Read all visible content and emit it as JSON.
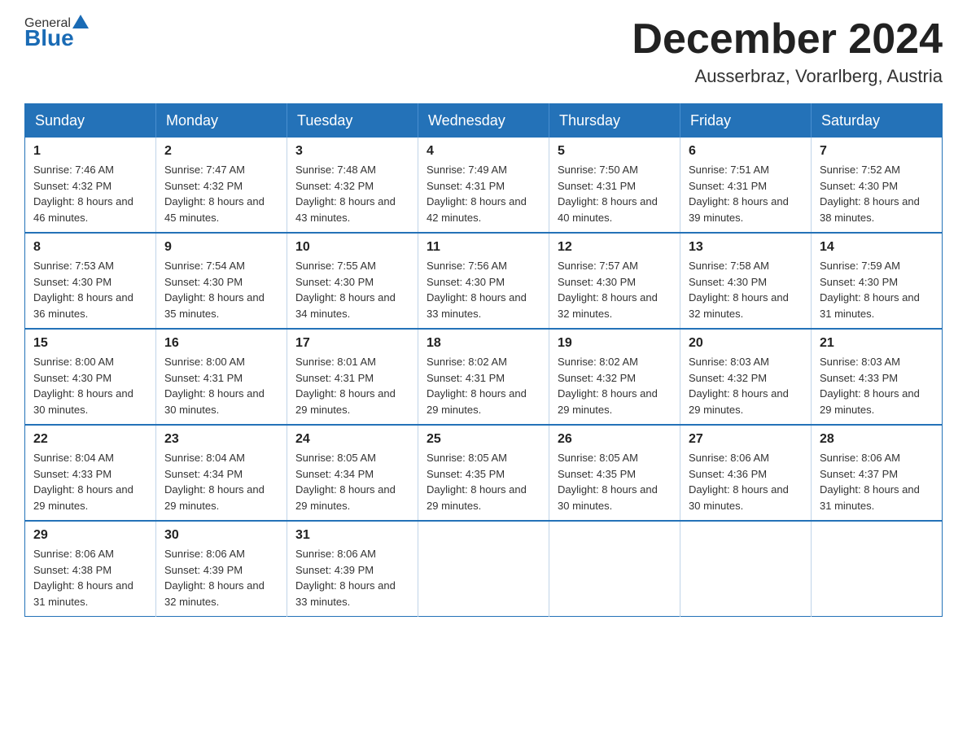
{
  "header": {
    "logo_general": "General",
    "logo_blue": "Blue",
    "month_title": "December 2024",
    "location": "Ausserbraz, Vorarlberg, Austria"
  },
  "weekdays": [
    "Sunday",
    "Monday",
    "Tuesday",
    "Wednesday",
    "Thursday",
    "Friday",
    "Saturday"
  ],
  "weeks": [
    [
      {
        "day": "1",
        "sunrise": "7:46 AM",
        "sunset": "4:32 PM",
        "daylight": "8 hours and 46 minutes."
      },
      {
        "day": "2",
        "sunrise": "7:47 AM",
        "sunset": "4:32 PM",
        "daylight": "8 hours and 45 minutes."
      },
      {
        "day": "3",
        "sunrise": "7:48 AM",
        "sunset": "4:32 PM",
        "daylight": "8 hours and 43 minutes."
      },
      {
        "day": "4",
        "sunrise": "7:49 AM",
        "sunset": "4:31 PM",
        "daylight": "8 hours and 42 minutes."
      },
      {
        "day": "5",
        "sunrise": "7:50 AM",
        "sunset": "4:31 PM",
        "daylight": "8 hours and 40 minutes."
      },
      {
        "day": "6",
        "sunrise": "7:51 AM",
        "sunset": "4:31 PM",
        "daylight": "8 hours and 39 minutes."
      },
      {
        "day": "7",
        "sunrise": "7:52 AM",
        "sunset": "4:30 PM",
        "daylight": "8 hours and 38 minutes."
      }
    ],
    [
      {
        "day": "8",
        "sunrise": "7:53 AM",
        "sunset": "4:30 PM",
        "daylight": "8 hours and 36 minutes."
      },
      {
        "day": "9",
        "sunrise": "7:54 AM",
        "sunset": "4:30 PM",
        "daylight": "8 hours and 35 minutes."
      },
      {
        "day": "10",
        "sunrise": "7:55 AM",
        "sunset": "4:30 PM",
        "daylight": "8 hours and 34 minutes."
      },
      {
        "day": "11",
        "sunrise": "7:56 AM",
        "sunset": "4:30 PM",
        "daylight": "8 hours and 33 minutes."
      },
      {
        "day": "12",
        "sunrise": "7:57 AM",
        "sunset": "4:30 PM",
        "daylight": "8 hours and 32 minutes."
      },
      {
        "day": "13",
        "sunrise": "7:58 AM",
        "sunset": "4:30 PM",
        "daylight": "8 hours and 32 minutes."
      },
      {
        "day": "14",
        "sunrise": "7:59 AM",
        "sunset": "4:30 PM",
        "daylight": "8 hours and 31 minutes."
      }
    ],
    [
      {
        "day": "15",
        "sunrise": "8:00 AM",
        "sunset": "4:30 PM",
        "daylight": "8 hours and 30 minutes."
      },
      {
        "day": "16",
        "sunrise": "8:00 AM",
        "sunset": "4:31 PM",
        "daylight": "8 hours and 30 minutes."
      },
      {
        "day": "17",
        "sunrise": "8:01 AM",
        "sunset": "4:31 PM",
        "daylight": "8 hours and 29 minutes."
      },
      {
        "day": "18",
        "sunrise": "8:02 AM",
        "sunset": "4:31 PM",
        "daylight": "8 hours and 29 minutes."
      },
      {
        "day": "19",
        "sunrise": "8:02 AM",
        "sunset": "4:32 PM",
        "daylight": "8 hours and 29 minutes."
      },
      {
        "day": "20",
        "sunrise": "8:03 AM",
        "sunset": "4:32 PM",
        "daylight": "8 hours and 29 minutes."
      },
      {
        "day": "21",
        "sunrise": "8:03 AM",
        "sunset": "4:33 PM",
        "daylight": "8 hours and 29 minutes."
      }
    ],
    [
      {
        "day": "22",
        "sunrise": "8:04 AM",
        "sunset": "4:33 PM",
        "daylight": "8 hours and 29 minutes."
      },
      {
        "day": "23",
        "sunrise": "8:04 AM",
        "sunset": "4:34 PM",
        "daylight": "8 hours and 29 minutes."
      },
      {
        "day": "24",
        "sunrise": "8:05 AM",
        "sunset": "4:34 PM",
        "daylight": "8 hours and 29 minutes."
      },
      {
        "day": "25",
        "sunrise": "8:05 AM",
        "sunset": "4:35 PM",
        "daylight": "8 hours and 29 minutes."
      },
      {
        "day": "26",
        "sunrise": "8:05 AM",
        "sunset": "4:35 PM",
        "daylight": "8 hours and 30 minutes."
      },
      {
        "day": "27",
        "sunrise": "8:06 AM",
        "sunset": "4:36 PM",
        "daylight": "8 hours and 30 minutes."
      },
      {
        "day": "28",
        "sunrise": "8:06 AM",
        "sunset": "4:37 PM",
        "daylight": "8 hours and 31 minutes."
      }
    ],
    [
      {
        "day": "29",
        "sunrise": "8:06 AM",
        "sunset": "4:38 PM",
        "daylight": "8 hours and 31 minutes."
      },
      {
        "day": "30",
        "sunrise": "8:06 AM",
        "sunset": "4:39 PM",
        "daylight": "8 hours and 32 minutes."
      },
      {
        "day": "31",
        "sunrise": "8:06 AM",
        "sunset": "4:39 PM",
        "daylight": "8 hours and 33 minutes."
      },
      null,
      null,
      null,
      null
    ]
  ],
  "labels": {
    "sunrise": "Sunrise:",
    "sunset": "Sunset:",
    "daylight": "Daylight:"
  }
}
